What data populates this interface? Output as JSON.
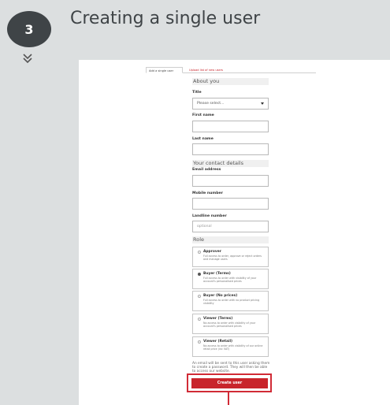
{
  "step": {
    "number": "3",
    "title": "Creating a single user"
  },
  "tabs": {
    "active": "Add a single user",
    "link": "Upload list of new users"
  },
  "sections": {
    "about": "About you",
    "contact": "Your contact details",
    "role": "Role"
  },
  "fields": {
    "title_label": "Title",
    "title_value": "Please select...",
    "first_name_label": "First name",
    "last_name_label": "Last name",
    "email_label": "Email address",
    "mobile_label": "Mobile number",
    "landline_label": "Landline number",
    "landline_placeholder": "optional"
  },
  "roles": [
    {
      "title": "Approver",
      "desc": "Full access to order, approve or reject orders and manage users",
      "selected": false
    },
    {
      "title": "Buyer (Terms)",
      "desc": "Full access to order with visibility of your account's personalised prices",
      "selected": true
    },
    {
      "title": "Buyer (No prices)",
      "desc": "Full access to order with no product pricing visibility",
      "selected": false
    },
    {
      "title": "Viewer (Terms)",
      "desc": "No access to order with visibility of your account's personalised prices",
      "selected": false
    },
    {
      "title": "Viewer (Retail)",
      "desc": "No access to order with visibility of our online retail price (inc VAT)",
      "selected": false
    }
  ],
  "note": "An email will be sent to this user asking them to create a password. They will then be able to access our website.",
  "actions": {
    "create_label": "Create user"
  },
  "colors": {
    "accent": "#c8242b",
    "highlight": "#d12b36",
    "badge": "#3f4447"
  }
}
